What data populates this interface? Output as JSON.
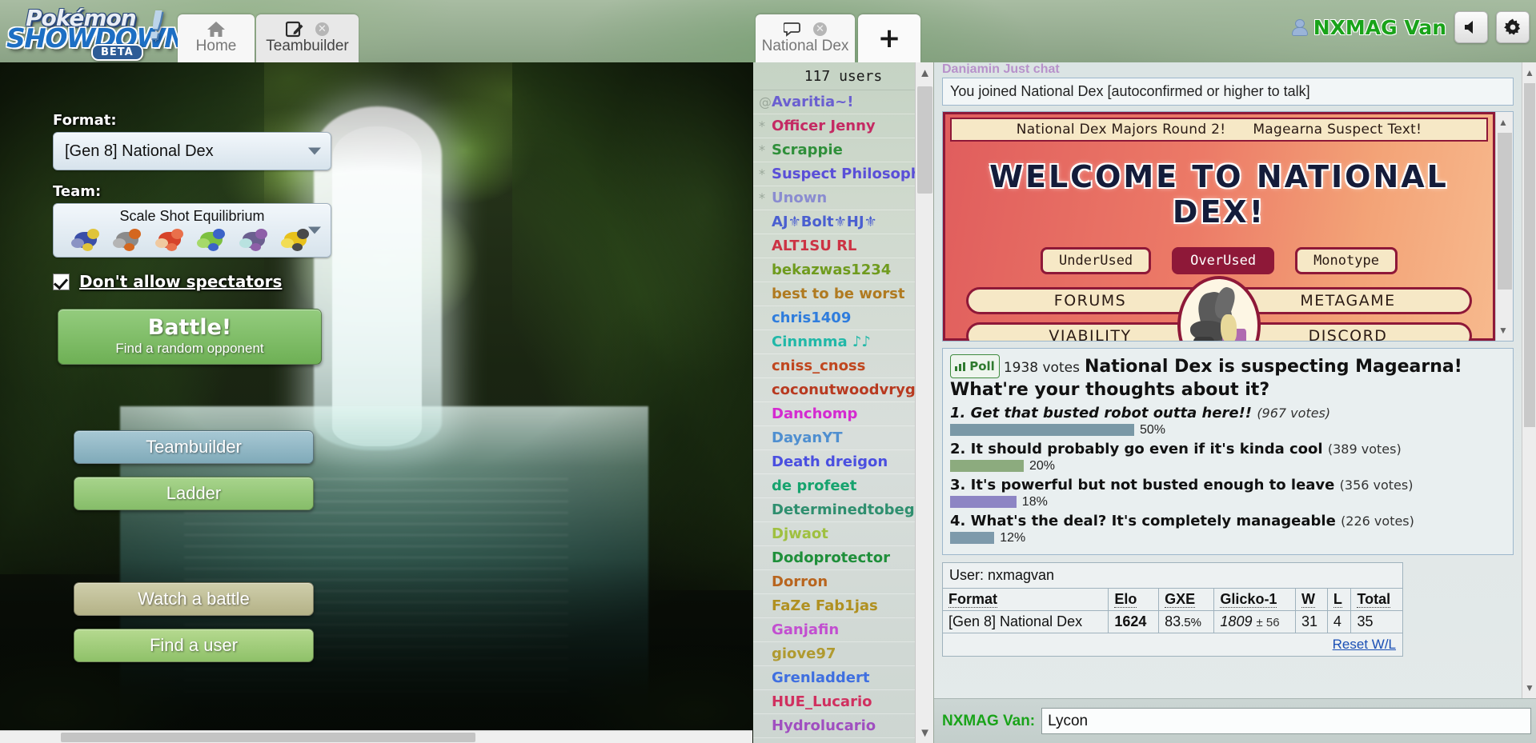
{
  "app": {
    "logo_pokemon": "Pokémon",
    "logo_showdown": "SHOWDOWN",
    "logo_beta": "BETA",
    "logo_bang": "!"
  },
  "tabs": [
    {
      "label": "Home",
      "icon": "home-icon",
      "active": false,
      "closable": false
    },
    {
      "label": "Teambuilder",
      "icon": "pencil-icon",
      "active": true,
      "closable": true
    },
    {
      "label": "National Dex",
      "icon": "chat-icon",
      "active": false,
      "closable": true
    }
  ],
  "add_tab_label": "+",
  "user": {
    "display_name": "NXMAG Van",
    "name_color": "#19a319",
    "icon": "user-icon",
    "sound_button": "sound-icon",
    "settings_button": "gear-icon"
  },
  "home": {
    "format_label": "Format:",
    "format_value": "[Gen 8] National Dex",
    "team_label": "Team:",
    "team_value": "Scale Shot Equilibrium",
    "team_sprites": [
      {
        "name": "sprite-1",
        "c1": "#3b4fa8",
        "c2": "#e0c43a",
        "c3": "#8a93c4"
      },
      {
        "name": "sprite-2",
        "c1": "#8b8b8b",
        "c2": "#d4671f",
        "c3": "#b5b5b5"
      },
      {
        "name": "sprite-3",
        "c1": "#d6432a",
        "c2": "#e9704b",
        "c3": "#f0c9a0"
      },
      {
        "name": "sprite-4",
        "c1": "#7cc040",
        "c2": "#3b63c8",
        "c3": "#a6d96a"
      },
      {
        "name": "sprite-5",
        "c1": "#6b5f8f",
        "c2": "#8e5fa8",
        "c3": "#b9e2e0"
      },
      {
        "name": "sprite-6",
        "c1": "#e8c11c",
        "c2": "#4a4a4a",
        "c3": "#f2dd55"
      }
    ],
    "spectators_label": "Don't allow spectators",
    "spectators_checked": true,
    "battle_title": "Battle!",
    "battle_subtitle": "Find a random opponent",
    "teambuilder_button": "Teambuilder",
    "ladder_button": "Ladder",
    "watch_button": "Watch a battle",
    "finduser_button": "Find a user"
  },
  "userlist": {
    "header": "117 users",
    "users": [
      {
        "rank": "@",
        "name": "Avaritia~!",
        "color": "#6a5fd0"
      },
      {
        "rank": "*",
        "name": "Officer Jenny",
        "color": "#c42a63"
      },
      {
        "rank": "*",
        "name": "Scrappie",
        "color": "#2f8f3a"
      },
      {
        "rank": "*",
        "name": "Suspect Philosophy",
        "color": "#5a4fd8"
      },
      {
        "rank": "*",
        "name": "Unown",
        "color": "#8a8cd0"
      },
      {
        "rank": "",
        "name": "AJ⚜Bolt⚜HJ⚜",
        "color": "#4a5fd0"
      },
      {
        "rank": "",
        "name": "ALT1SU RL",
        "color": "#cc3344"
      },
      {
        "rank": "",
        "name": "bekazwas1234",
        "color": "#6f9b1e"
      },
      {
        "rank": "",
        "name": "best to be worst",
        "color": "#b07a20"
      },
      {
        "rank": "",
        "name": "chris1409",
        "color": "#2f7ddd"
      },
      {
        "rank": "",
        "name": "Cinnmma ♪♪",
        "color": "#21b8a8"
      },
      {
        "rank": "",
        "name": "cniss_cnoss",
        "color": "#c0471f"
      },
      {
        "rank": "",
        "name": "coconutwoodvrygood",
        "color": "#b83a20"
      },
      {
        "rank": "",
        "name": "Danchomp",
        "color": "#d42ad0"
      },
      {
        "rank": "",
        "name": "DayanYT",
        "color": "#4f8fd0"
      },
      {
        "rank": "",
        "name": "Death dreigon",
        "color": "#4a4fe0"
      },
      {
        "rank": "",
        "name": "de profeet",
        "color": "#16a36e"
      },
      {
        "rank": "",
        "name": "Determinedtobegood",
        "color": "#2f8f6f"
      },
      {
        "rank": "",
        "name": "Djwaot",
        "color": "#9fc040"
      },
      {
        "rank": "",
        "name": "Dodoprotector",
        "color": "#1f8f3a"
      },
      {
        "rank": "",
        "name": "Dorron",
        "color": "#b8651f"
      },
      {
        "rank": "",
        "name": "FaZe Fab1jas",
        "color": "#b09020"
      },
      {
        "rank": "",
        "name": "Ganjafin",
        "color": "#c24fd0"
      },
      {
        "rank": "",
        "name": "giove97",
        "color": "#b09a30"
      },
      {
        "rank": "",
        "name": "Grenladdert",
        "color": "#3f6fe0"
      },
      {
        "rank": "",
        "name": "HUE_Lucario",
        "color": "#d0305f"
      },
      {
        "rank": "",
        "name": "Hydrolucario",
        "color": "#a04fc0"
      }
    ]
  },
  "chat": {
    "cut_line": "Danjamin  Just chat",
    "joined_message": "You joined National Dex [autoconfirmed or higher to talk]",
    "input_value": "Lycon",
    "input_placeholder": "",
    "username_prefix": "NXMAG Van:"
  },
  "banner": {
    "headline_left": "National Dex Majors Round 2!",
    "headline_right": "Magearna Suspect Text!",
    "title": "WELCOME TO NATIONAL DEX!",
    "tiers": [
      {
        "label": "UnderUsed",
        "selected": false
      },
      {
        "label": "OverUsed",
        "selected": true
      },
      {
        "label": "Monotype",
        "selected": false
      }
    ],
    "links": [
      {
        "label": "FORUMS"
      },
      {
        "label": "METAGAME"
      },
      {
        "label": "VIABILITY"
      },
      {
        "label": "DISCORD"
      }
    ],
    "mascot": "pokemon-mascot-icon",
    "accent_dark": "#8e1838",
    "accent_cream": "#f6e8c6"
  },
  "poll": {
    "tag": "Poll",
    "tag_icon": "bar-chart-icon",
    "votes_label": "1938 votes",
    "question": "National Dex is suspecting Magearna! What're your thoughts about it?",
    "options": [
      {
        "number": "1.",
        "text": "Get that busted robot outta here!!",
        "votes": "(967 votes)",
        "percent": "50%",
        "pct": 50,
        "color": "#7a98a6",
        "voted": true
      },
      {
        "number": "2.",
        "text": "It should probably go even if it's kinda cool",
        "votes": "(389 votes)",
        "percent": "20%",
        "pct": 20,
        "color": "#8cab7e",
        "voted": false
      },
      {
        "number": "3.",
        "text": "It's powerful but not busted enough to leave",
        "votes": "(356 votes)",
        "percent": "18%",
        "pct": 18,
        "color": "#8d85c4",
        "voted": false
      },
      {
        "number": "4.",
        "text": "What's the deal? It's completely manageable",
        "votes": "(226 votes)",
        "percent": "12%",
        "pct": 12,
        "color": "#7d9aab",
        "voted": false
      }
    ]
  },
  "ladder": {
    "user_line": "User: nxmagvan",
    "headers": [
      "Format",
      "Elo",
      "GXE",
      "Glicko-1",
      "W",
      "L",
      "Total"
    ],
    "row": {
      "format": "[Gen 8] National Dex",
      "elo": "1624",
      "gxe_int": "83",
      "gxe_dec": ".5%",
      "glicko": "1809",
      "glicko_dev": "± 56",
      "wins": "31",
      "losses": "4",
      "total": "35"
    },
    "reset_label": "Reset W/L"
  }
}
